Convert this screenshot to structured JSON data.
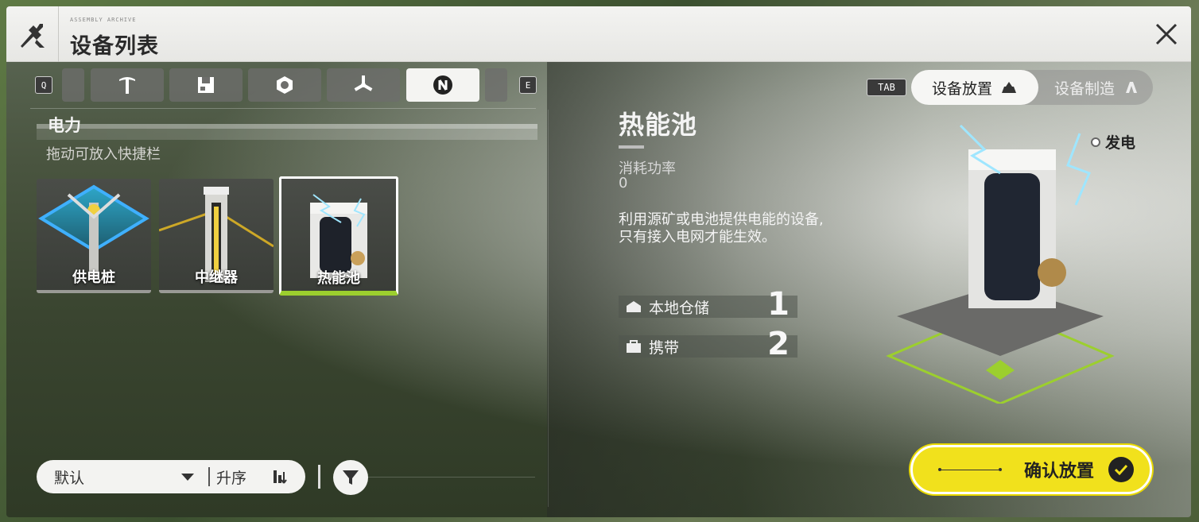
{
  "header": {
    "brand_small": "ASSEMBLY ARCHIVE",
    "title": "设备列表"
  },
  "tabs": {
    "prev_key": "Q",
    "next_key": "E",
    "items": [
      {
        "icon": "partial-tab"
      },
      {
        "icon": "pickaxe-icon"
      },
      {
        "icon": "storage-icon"
      },
      {
        "icon": "nut-icon"
      },
      {
        "icon": "fan-icon"
      },
      {
        "icon": "power-icon",
        "active": true
      },
      {
        "icon": "partial-tab"
      }
    ]
  },
  "section": {
    "title": "电力",
    "hint": "拖动可放入快捷栏"
  },
  "items": [
    {
      "label": "供电桩"
    },
    {
      "label": "中继器"
    },
    {
      "label": "热能池",
      "selected": true
    }
  ],
  "sort": {
    "default_label": "默认",
    "order_label": "升序"
  },
  "mode": {
    "key": "TAB",
    "active_label": "设备放置",
    "inactive_label": "设备制造"
  },
  "detail": {
    "name": "热能池",
    "power_label": "消耗功率",
    "power_value": "0",
    "desc_line1": "利用源矿或电池提供电能的设备,",
    "desc_line2": "只有接入电网才能生效。",
    "power_tag": "发电",
    "stock": [
      {
        "label": "本地仓储",
        "value": "1"
      },
      {
        "label": "携带",
        "value": "2"
      }
    ]
  },
  "confirm": {
    "label": "确认放置"
  },
  "colors": {
    "accent_yellow": "#f1e11c",
    "selected_green": "#9ccf2e"
  }
}
